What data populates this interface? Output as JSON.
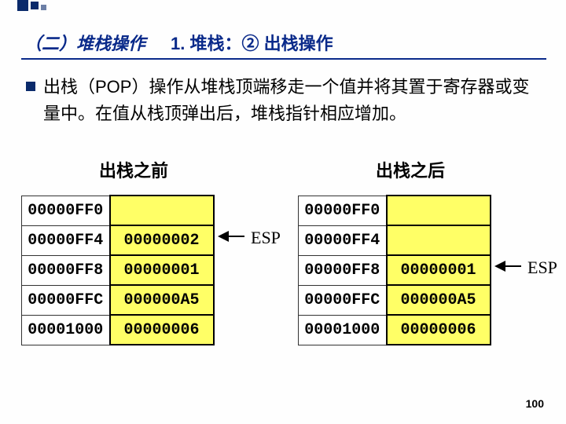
{
  "header": {
    "left": "（二）堆栈操作",
    "right": "1. 堆栈：② 出栈操作"
  },
  "paragraph": "出栈（POP）操作从堆栈顶端移走一个值并将其置于寄存器或变量中。在值从栈顶弹出后，堆栈指针相应增加。",
  "before": {
    "title": "出栈之前",
    "rows": [
      {
        "addr": "00000FF0",
        "val": ""
      },
      {
        "addr": "00000FF4",
        "val": "00000002"
      },
      {
        "addr": "00000FF8",
        "val": "00000001"
      },
      {
        "addr": "00000FFC",
        "val": "000000A5"
      },
      {
        "addr": "00001000",
        "val": "00000006"
      }
    ],
    "esp": "ESP"
  },
  "after": {
    "title": "出栈之后",
    "rows": [
      {
        "addr": "00000FF0",
        "val": ""
      },
      {
        "addr": "00000FF4",
        "val": ""
      },
      {
        "addr": "00000FF8",
        "val": "00000001"
      },
      {
        "addr": "00000FFC",
        "val": "000000A5"
      },
      {
        "addr": "00001000",
        "val": "00000006"
      }
    ],
    "esp": "ESP"
  },
  "pageNum": "100"
}
